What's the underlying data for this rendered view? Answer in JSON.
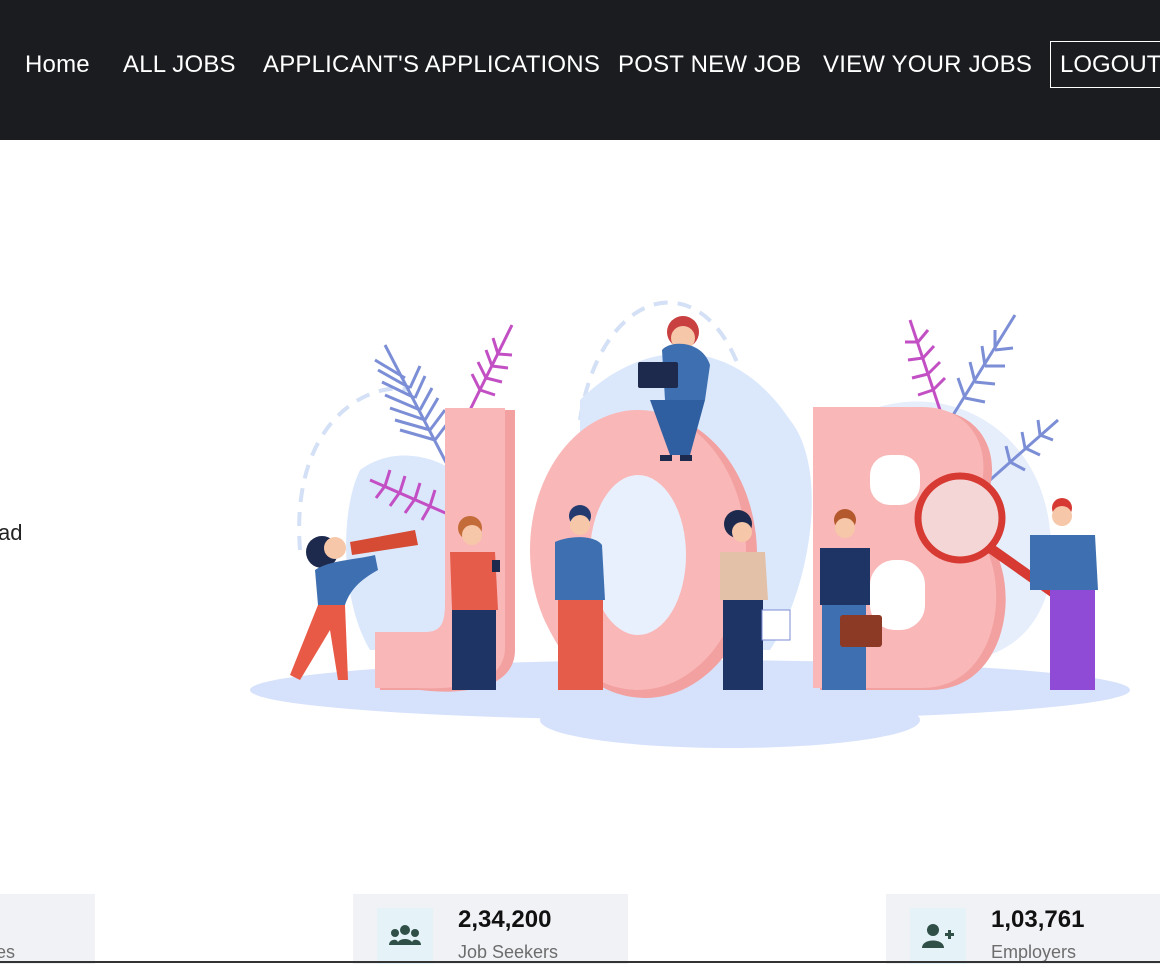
{
  "nav": {
    "home": "Home",
    "all_jobs": "ALL JOBS",
    "applications": "APPLICANT'S APPLICATIONS",
    "post_job": "POST NEW JOB",
    "view_jobs": "VIEW YOUR JOBS",
    "logout": "LOGOUT"
  },
  "hero": {
    "text_fragment": "ad",
    "illustration_text": "JOB"
  },
  "stats": {
    "left_label_fragment": "es",
    "job_seekers": {
      "number": "2,34,200",
      "label": "Job Seekers",
      "icon": "users-icon"
    },
    "employers": {
      "number": "1,03,761",
      "label": "Employers",
      "icon": "user-plus-icon"
    }
  },
  "colors": {
    "navbar_bg": "#1b1c1f",
    "card_bg": "#f1f2f6",
    "icon_box_bg": "#e5f3f9",
    "icon_color": "#2f4f47",
    "letters": "#f7a8a8"
  }
}
